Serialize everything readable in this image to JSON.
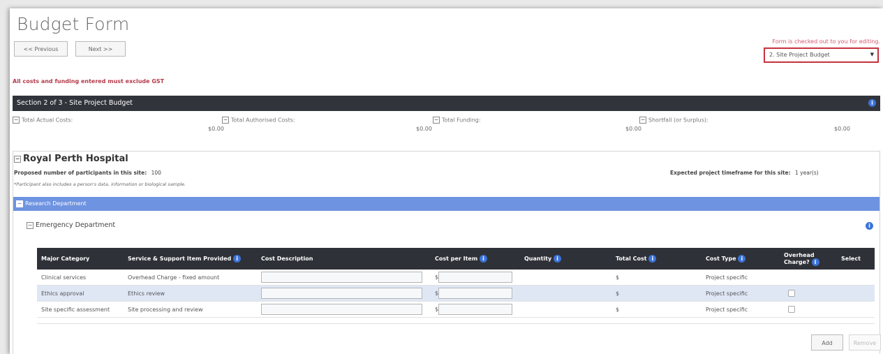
{
  "page": {
    "title": "Budget Form",
    "prev_label": "<< Previous",
    "next_label": "Next >>",
    "checkout_text": "Form is checked out to you for editing.",
    "section_select": "2. Site Project Budget",
    "gst_note": "All costs and funding entered must exclude GST"
  },
  "section": {
    "title": "Section 2 of 3 - Site Project Budget",
    "totals": [
      {
        "label": "Total Actual Costs:",
        "value": "$0.00"
      },
      {
        "label": "Total Authorised Costs:",
        "value": "$0.00"
      },
      {
        "label": "Total Funding:",
        "value": "$0.00"
      },
      {
        "label": "Shortfall (or Surplus):",
        "value": "$0.00"
      }
    ]
  },
  "site": {
    "name": "Royal Perth Hospital",
    "participants_label": "Proposed number of participants in this site:",
    "participants_value": "100",
    "timeframe_label": "Expected project timeframe for this site:",
    "timeframe_value": "1 year(s)",
    "footnote": "*Participant also includes a person's data, information or biological sample."
  },
  "department": {
    "name": "Research Department",
    "sub_name": "Emergency Department"
  },
  "table": {
    "headers": [
      "Major Category",
      "Service & Support Item Provided",
      "Cost Description",
      "Cost per Item",
      "Quantity",
      "Total Cost",
      "Cost Type",
      "Overhead Charge?",
      "Select"
    ],
    "currency": "$",
    "rows": [
      {
        "category": "Clinical services",
        "item": "Overhead Charge - fixed amount",
        "total": "$",
        "type": "Project specific"
      },
      {
        "category": "Ethics approval",
        "item": "Ethics review",
        "total": "$",
        "type": "Project specific"
      },
      {
        "category": "Site specific assessment",
        "item": "Site processing and review",
        "total": "$",
        "type": "Project specific"
      }
    ]
  },
  "actions": {
    "add_label": "Add",
    "remove_label": "Remove"
  }
}
